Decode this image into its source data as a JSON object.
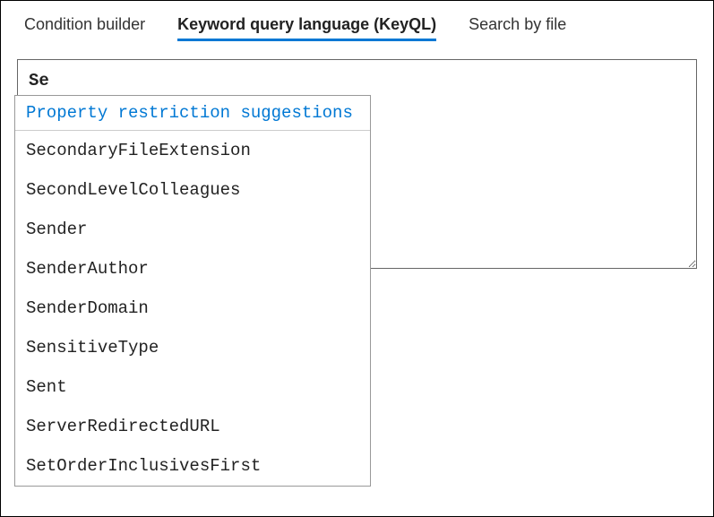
{
  "tabs": {
    "condition_builder": "Condition builder",
    "keyql": "Keyword query language (KeyQL)",
    "search_by_file": "Search by file"
  },
  "query": {
    "value": "Se"
  },
  "suggestions": {
    "header": "Property restriction suggestions",
    "items": [
      "SecondaryFileExtension",
      "SecondLevelColleagues",
      "Sender",
      "SenderAuthor",
      "SenderDomain",
      "SensitiveType",
      "Sent",
      "ServerRedirectedURL",
      "SetOrderInclusivesFirst"
    ]
  }
}
